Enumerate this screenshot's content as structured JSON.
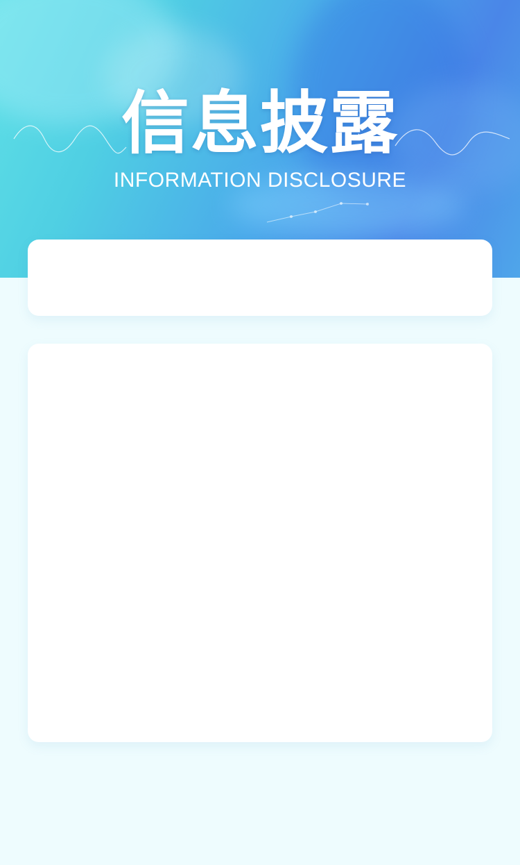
{
  "header": {
    "title": "信息披露",
    "subtitle": "INFORMATION DISCLOSURE"
  },
  "colors": {
    "page_background": "#eefcfe",
    "card_background": "#ffffff",
    "text": "#ffffff"
  }
}
